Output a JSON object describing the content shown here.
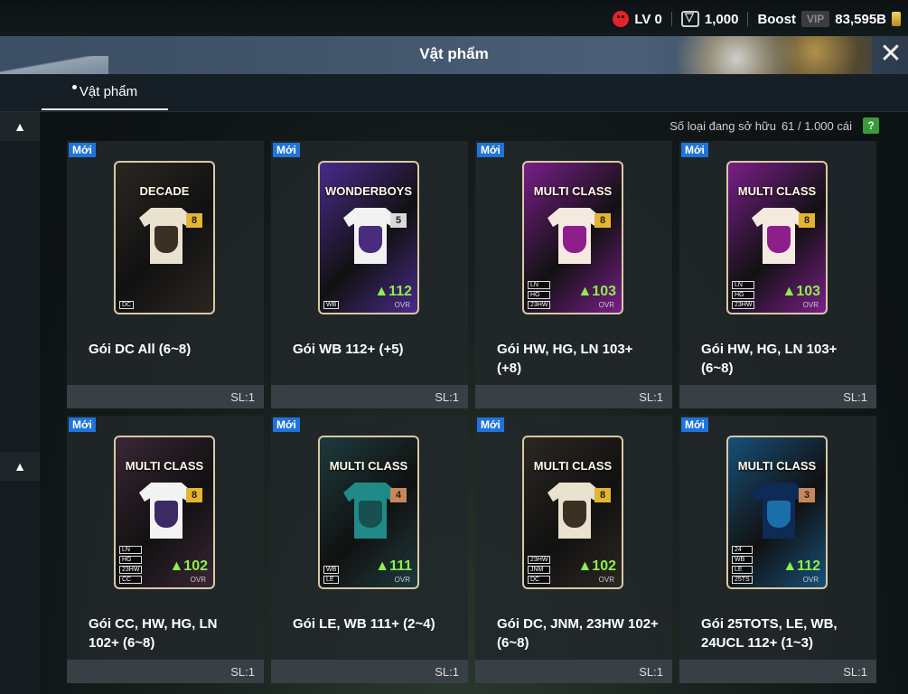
{
  "resources": {
    "level": "LV 0",
    "coins": "1,000",
    "boost_label": "Boost",
    "vip_label": "VIP",
    "bp": "83,595B"
  },
  "header": {
    "title": "Vật phẩm"
  },
  "tabs": [
    {
      "label": "Vật phẩm"
    }
  ],
  "inventory": {
    "owned_text": "Số loại đang sở hữu",
    "owned_count": "61 / 1.000 cái",
    "help_label": "?"
  },
  "items": [
    {
      "badge": "Mới",
      "pack_label": "DECADE",
      "number": "8",
      "ovr": "",
      "title": "Gói DC All (6~8)",
      "qty": "SL:1",
      "bg": "#2b2722",
      "shirt": "#e9e2cf",
      "crest": "#3a3124",
      "num_color": "#e3b531",
      "tags": [
        "DC"
      ]
    },
    {
      "badge": "Mới",
      "pack_label": "WONDERBOYS",
      "number": "5",
      "ovr": "▲112",
      "title": "Gói WB 112+ (+5)",
      "qty": "SL:1",
      "bg": "#4a2a8c",
      "shirt": "#f2f2f2",
      "crest": "#4b2b7c",
      "num_color": "#d9d9d9",
      "tags": [
        "WB"
      ]
    },
    {
      "badge": "Mới",
      "pack_label": "MULTI CLASS",
      "number": "8",
      "ovr": "▲103",
      "title": "Gói HW, HG, LN 103+ (+8)",
      "qty": "SL:1",
      "bg": "#7a1e8a",
      "shirt": "#f4eadf",
      "crest": "#8e1e8c",
      "num_color": "#e3b531",
      "tags": [
        "LN",
        "HG",
        "23HW"
      ]
    },
    {
      "badge": "Mới",
      "pack_label": "MULTI CLASS",
      "number": "8",
      "ovr": "▲103",
      "title": "Gói HW, HG, LN 103+ (6~8)",
      "qty": "SL:1",
      "bg": "#7a1e8a",
      "shirt": "#f4eadf",
      "crest": "#8e1e8c",
      "num_color": "#e3b531",
      "tags": [
        "LN",
        "HG",
        "23HW"
      ]
    },
    {
      "badge": "Mới",
      "pack_label": "MULTI CLASS",
      "number": "8",
      "ovr": "▲102",
      "title": "Gói CC, HW, HG, LN 102+ (6~8)",
      "qty": "SL:1",
      "bg": "#3a2636",
      "shirt": "#f3f3f3",
      "crest": "#3b2a63",
      "num_color": "#e3b531",
      "tags": [
        "LN",
        "HG",
        "23HW",
        "CC"
      ]
    },
    {
      "badge": "Mới",
      "pack_label": "MULTI CLASS",
      "number": "4",
      "ovr": "▲111",
      "title": "Gói LE, WB 111+ (2~4)",
      "qty": "SL:1",
      "bg": "#1d3a3c",
      "shirt": "#1f8a88",
      "crest": "#17504f",
      "num_color": "#c8875a",
      "tags": [
        "WB",
        "LE"
      ]
    },
    {
      "badge": "Mới",
      "pack_label": "MULTI CLASS",
      "number": "8",
      "ovr": "▲102",
      "title": "Gói DC, JNM, 23HW 102+ (6~8)",
      "qty": "SL:1",
      "bg": "#2b2722",
      "shirt": "#e9e2cf",
      "crest": "#3a3124",
      "num_color": "#e3b531",
      "tags": [
        "23HW",
        "JNM",
        "DC"
      ]
    },
    {
      "badge": "Mới",
      "pack_label": "MULTI CLASS",
      "number": "3",
      "ovr": "▲112",
      "title": "Gói 25TOTS, LE, WB, 24UCL 112+ (1~3)",
      "qty": "SL:1",
      "bg": "#17507a",
      "shirt": "#0e2b55",
      "crest": "#1b6fa8",
      "num_color": "#c8875a",
      "tags": [
        "24",
        "WB",
        "LE",
        "25TS"
      ]
    }
  ]
}
